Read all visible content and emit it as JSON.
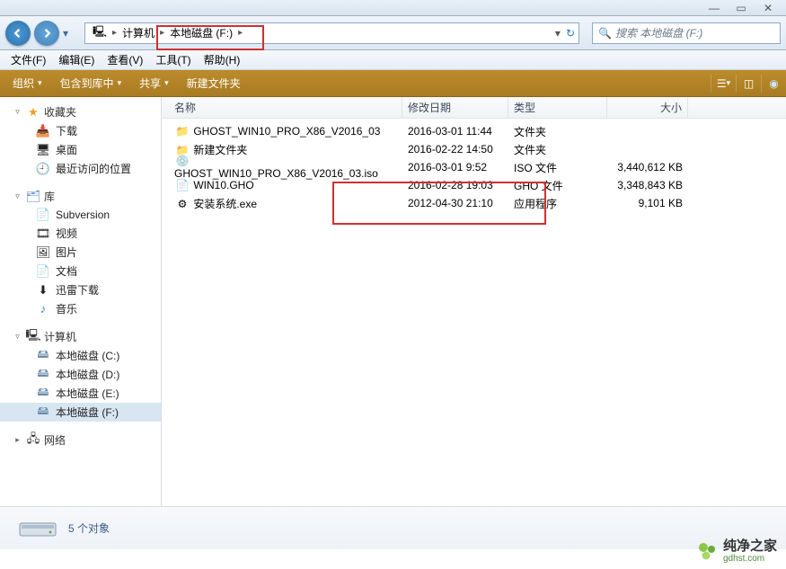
{
  "titlebar": {
    "min": "—",
    "max": "▭",
    "close": "✕"
  },
  "nav": {
    "crumbs": [
      "计算机",
      "本地磁盘 (F:)"
    ],
    "search_placeholder": "搜索 本地磁盘 (F:)"
  },
  "menu": {
    "file": "文件(F)",
    "edit": "编辑(E)",
    "view": "查看(V)",
    "tools": "工具(T)",
    "help": "帮助(H)"
  },
  "toolbar": {
    "organize": "组织",
    "include": "包含到库中",
    "share": "共享",
    "newfolder": "新建文件夹"
  },
  "sidebar": {
    "favorites": {
      "label": "收藏夹",
      "items": [
        "下载",
        "桌面",
        "最近访问的位置"
      ]
    },
    "library": {
      "label": "库",
      "items": [
        "Subversion",
        "视频",
        "图片",
        "文档",
        "迅雷下载",
        "音乐"
      ]
    },
    "computer": {
      "label": "计算机",
      "items": [
        "本地磁盘 (C:)",
        "本地磁盘 (D:)",
        "本地磁盘 (E:)",
        "本地磁盘 (F:)"
      ]
    },
    "network": {
      "label": "网络"
    }
  },
  "columns": {
    "name": "名称",
    "date": "修改日期",
    "type": "类型",
    "size": "大小"
  },
  "files": [
    {
      "icon": "📁",
      "name": "GHOST_WIN10_PRO_X86_V2016_03",
      "date": "2016-03-01 11:44",
      "type": "文件夹",
      "size": ""
    },
    {
      "icon": "📁",
      "name": "新建文件夹",
      "date": "2016-02-22 14:50",
      "type": "文件夹",
      "size": ""
    },
    {
      "icon": "💿",
      "name": "GHOST_WIN10_PRO_X86_V2016_03.iso",
      "date": "2016-03-01 9:52",
      "type": "ISO 文件",
      "size": "3,440,612 KB"
    },
    {
      "icon": "📄",
      "name": "WIN10.GHO",
      "date": "2016-02-28 19:03",
      "type": "GHO 文件",
      "size": "3,348,843 KB"
    },
    {
      "icon": "⚙",
      "name": "安装系统.exe",
      "date": "2012-04-30 21:10",
      "type": "应用程序",
      "size": "9,101 KB"
    }
  ],
  "status": {
    "count": "5 个对象"
  },
  "watermark": {
    "name": "纯净之家",
    "url": "gdhst.com"
  }
}
